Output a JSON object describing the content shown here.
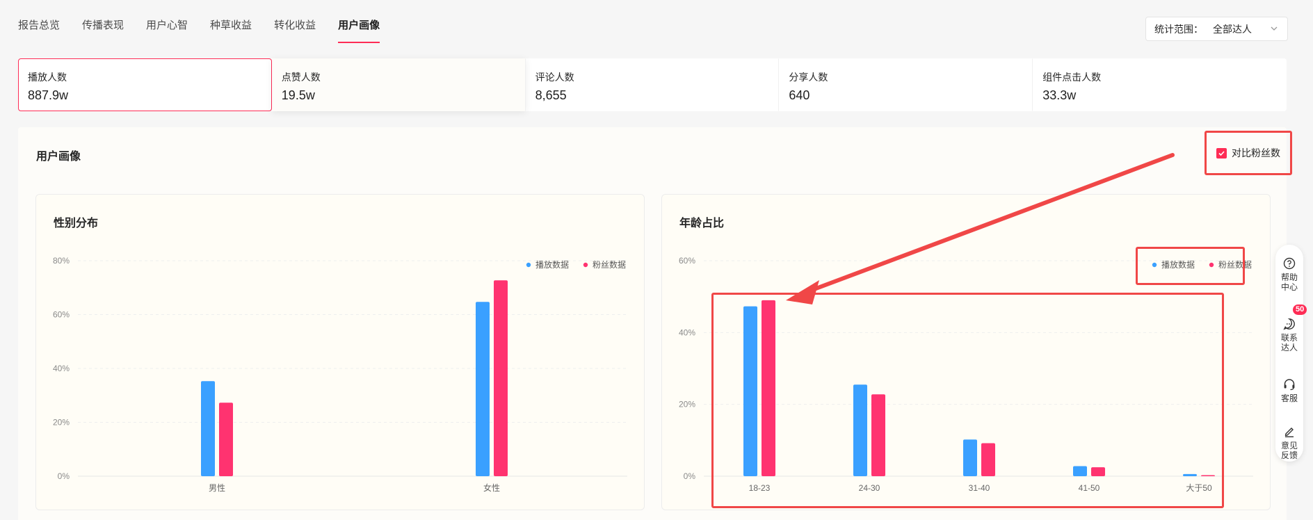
{
  "tabs": [
    {
      "label": "报告总览",
      "active": false
    },
    {
      "label": "传播表现",
      "active": false
    },
    {
      "label": "用户心智",
      "active": false
    },
    {
      "label": "种草收益",
      "active": false
    },
    {
      "label": "转化收益",
      "active": false
    },
    {
      "label": "用户画像",
      "active": true
    }
  ],
  "scope": {
    "label": "统计范围：",
    "value": "全部达人",
    "icon": "chevron-down-icon"
  },
  "metrics": [
    {
      "label": "播放人数",
      "value": "887.9w"
    },
    {
      "label": "点赞人数",
      "value": "19.5w"
    },
    {
      "label": "评论人数",
      "value": "8,655"
    },
    {
      "label": "分享人数",
      "value": "640"
    },
    {
      "label": "组件点击人数",
      "value": "33.3w"
    }
  ],
  "portrait": {
    "title": "用户画像",
    "compare_label": "对比粉丝数",
    "compare_checked": true
  },
  "colors": {
    "play": "#3aa0ff",
    "fans": "#ff3370",
    "accent": "#fe2c55",
    "annotation": "#f04747"
  },
  "chart_data": [
    {
      "type": "bar",
      "title": "性别分布",
      "categories": [
        "男性",
        "女性"
      ],
      "series": [
        {
          "name": "播放数据",
          "values": [
            35.3,
            64.7
          ]
        },
        {
          "name": "粉丝数据",
          "values": [
            27.3,
            72.7
          ]
        }
      ],
      "ylim": [
        0,
        80
      ],
      "yticks": [
        "0%",
        "20%",
        "40%",
        "60%",
        "80%"
      ],
      "legend": "top-right",
      "grid": true
    },
    {
      "type": "bar",
      "title": "年龄占比",
      "categories": [
        "18-23",
        "24-30",
        "31-40",
        "41-50",
        "大于50"
      ],
      "series": [
        {
          "name": "播放数据",
          "values": [
            47.3,
            25.5,
            10.2,
            2.8,
            0.6
          ]
        },
        {
          "name": "粉丝数据",
          "values": [
            49.0,
            22.8,
            9.2,
            2.5,
            0.3
          ]
        }
      ],
      "ylim": [
        0,
        60
      ],
      "yticks": [
        "0%",
        "20%",
        "40%",
        "60%"
      ],
      "legend": "top-right",
      "grid": true
    }
  ],
  "sidebar": [
    {
      "label": "帮助中心",
      "icon": "help-circle-icon"
    },
    {
      "label": "联系达人",
      "icon": "chat-bubble-icon",
      "badge": "50"
    },
    {
      "label": "客服",
      "icon": "headset-icon"
    },
    {
      "label": "意见反馈",
      "icon": "edit-pen-icon"
    }
  ]
}
